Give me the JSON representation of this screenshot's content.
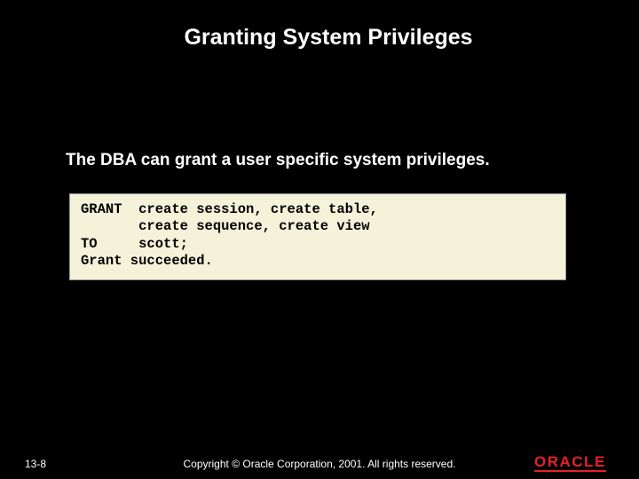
{
  "title": "Granting System Privileges",
  "body": "The DBA can grant a user specific system privileges.",
  "code": "GRANT  create session, create table,\n       create sequence, create view\nTO     scott;\nGrant succeeded.",
  "footer": {
    "slide_number": "13-8",
    "copyright": "Copyright © Oracle Corporation, 2001. All rights reserved.",
    "logo_text": "ORACLE"
  }
}
